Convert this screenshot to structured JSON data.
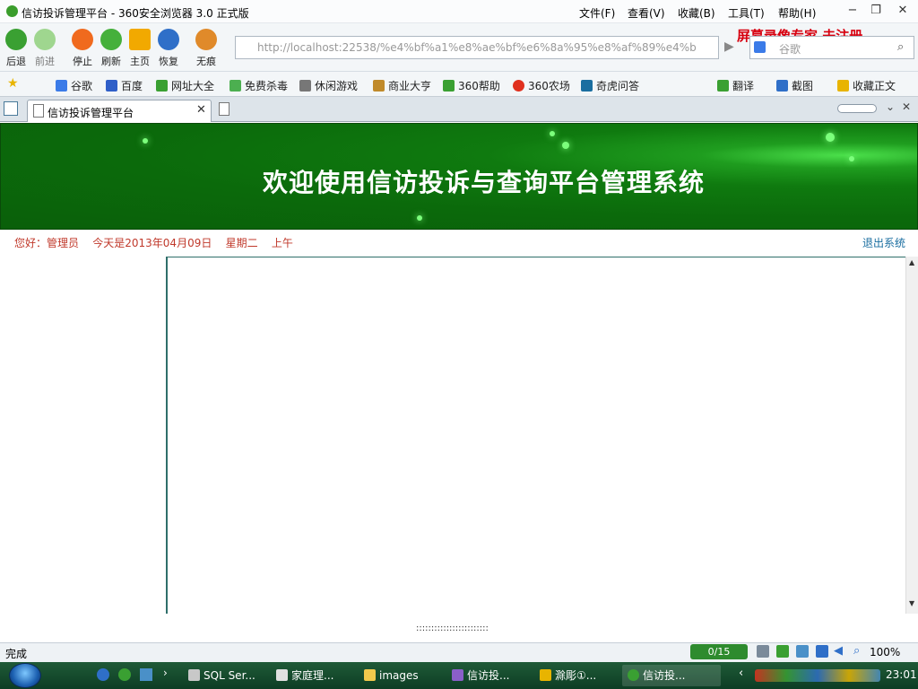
{
  "window": {
    "title": "信访投诉管理平台 - 360安全浏览器 3.0 正式版",
    "menu": [
      "文件(F)",
      "查看(V)",
      "收藏(B)",
      "工具(T)",
      "帮助(H)"
    ],
    "controls": [
      "−",
      "❐",
      "✕"
    ]
  },
  "toolbar": {
    "buttons": [
      {
        "label": "后退",
        "color": "#3aa032"
      },
      {
        "label": "前进",
        "color": "#8fcf7e"
      },
      {
        "label": "停止",
        "color": "#f06a1e"
      },
      {
        "label": "刷新",
        "color": "#45b03b"
      },
      {
        "label": "主页",
        "color": "#f2a900"
      },
      {
        "label": "恢复",
        "color": "#2f6fc8"
      },
      {
        "label": "无痕",
        "color": "#e08a2a"
      }
    ],
    "url": "http://localhost:22538/%e4%bf%a1%e8%ae%bf%e6%8a%95%e8%af%89%e4%b8%",
    "recorder_text": "屏幕录像专家  未注册",
    "search_placeholder": "谷歌"
  },
  "bookmarks": {
    "items": [
      {
        "label": "谷歌",
        "color": "#3b7be8"
      },
      {
        "label": "百度",
        "color": "#2f5fc8"
      },
      {
        "label": "网址大全",
        "color": "#3aa032"
      },
      {
        "label": "免费杀毒",
        "color": "#4caf50"
      },
      {
        "label": "休闲游戏",
        "color": "#777777"
      },
      {
        "label": "商业大亨",
        "color": "#c08a2a"
      },
      {
        "label": "360帮助",
        "color": "#3aa032"
      },
      {
        "label": "360农场",
        "color": "#e0301e"
      },
      {
        "label": "奇虎问答",
        "color": "#1a6ea0"
      }
    ],
    "right": [
      "翻译",
      "截图",
      "收藏正文"
    ]
  },
  "tabs": [
    {
      "label": "信访投诉管理平台"
    }
  ],
  "page": {
    "banner_title": "欢迎使用信访投诉与查询平台管理系统",
    "welcome": "您好：管理员    今天是2013年04月09日    星期二    上午",
    "logout": "退出系统",
    "splitter": "::::::::::::::::::::::::"
  },
  "status": {
    "text": "完成",
    "counter": "0/15",
    "zoom": "100%"
  },
  "taskbar": {
    "tasks": [
      "SQL Ser...",
      "家庭理...",
      "images",
      "信访投...",
      "滁彫①...",
      "信访投..."
    ],
    "clock": "23:01"
  }
}
